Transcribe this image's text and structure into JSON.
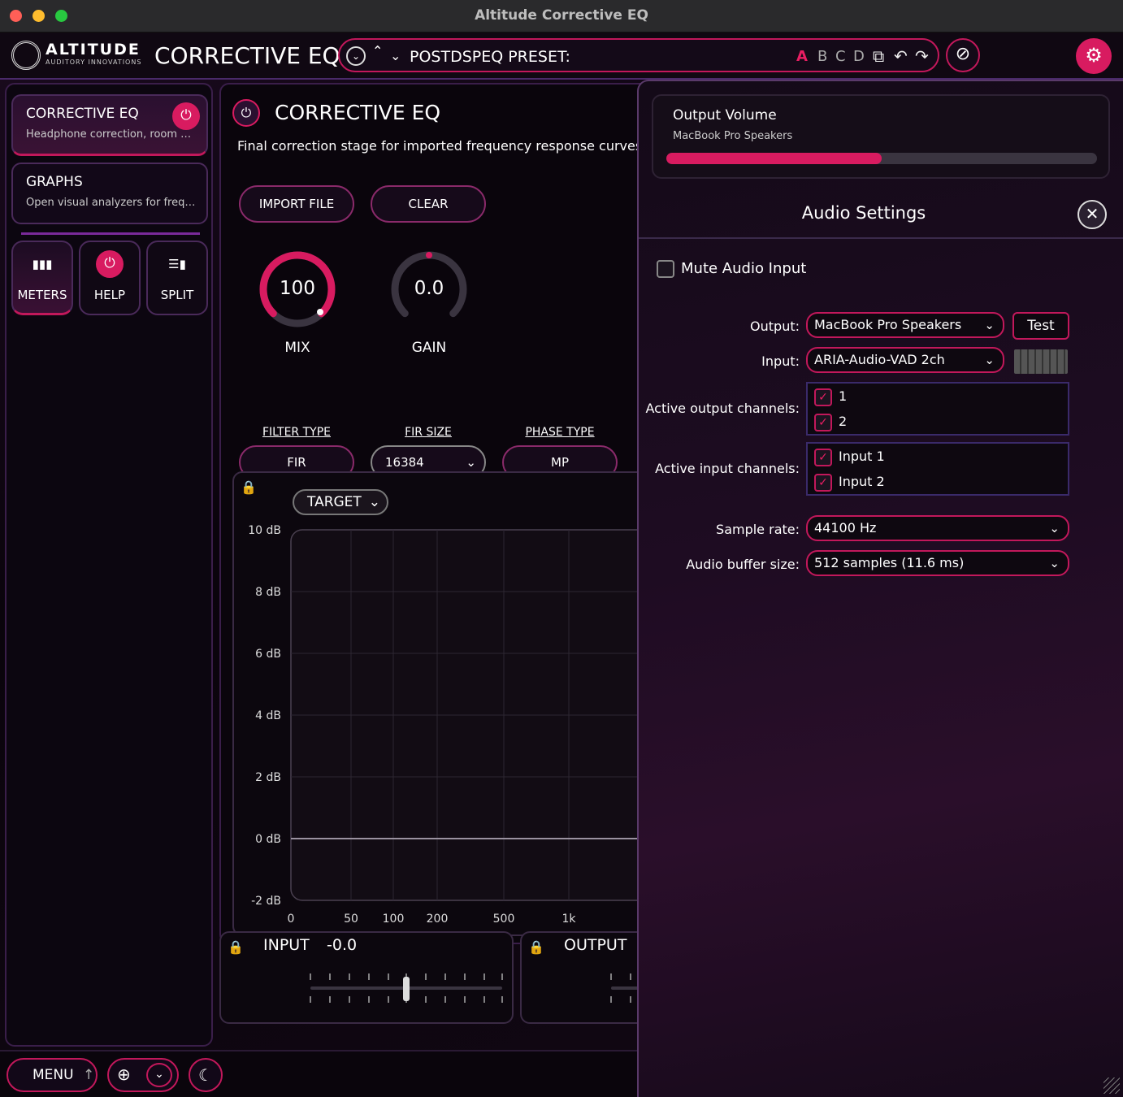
{
  "window": {
    "title": "Altitude Corrective EQ"
  },
  "topbar": {
    "brand": "ALTITUDE",
    "brand_sub": "AUDITORY INNOVATIONS",
    "app_title": "CORRECTIVE EQ",
    "preset_label": "POSTDSPEQ PRESET:",
    "slots": [
      "A",
      "B",
      "C",
      "D"
    ],
    "active_slot": "A"
  },
  "sidebar": {
    "modules": [
      {
        "title": "CORRECTIVE EQ",
        "subtitle": "Headphone correction, room cor..."
      },
      {
        "title": "GRAPHS",
        "subtitle": "Open visual analyzers for freque..."
      }
    ],
    "tools": [
      {
        "label": "METERS",
        "icon": "bar-chart-icon"
      },
      {
        "label": "HELP",
        "icon": "power-icon"
      },
      {
        "label": "SPLIT",
        "icon": "split-icon"
      }
    ]
  },
  "main": {
    "title": "CORRECTIVE EQ",
    "description": "Final correction stage for imported frequency response curves.",
    "buttons": {
      "import": "IMPORT FILE",
      "clear": "CLEAR"
    },
    "knobs": [
      {
        "label": "MIX",
        "value": "100"
      },
      {
        "label": "GAIN",
        "value": "0.0"
      }
    ],
    "params": [
      {
        "label": "FILTER TYPE",
        "value": "FIR"
      },
      {
        "label": "FIR SIZE",
        "value": "16384"
      },
      {
        "label": "PHASE TYPE",
        "value": "MP"
      }
    ],
    "graph": {
      "target_label": "TARGET",
      "y_ticks": [
        "10 dB",
        "8 dB",
        "6 dB",
        "4 dB",
        "2 dB",
        "0 dB",
        "-2 dB"
      ],
      "x_ticks": [
        "0",
        "50",
        "100",
        "200",
        "500",
        "1k"
      ]
    },
    "input": {
      "label": "INPUT",
      "value": "-0.0"
    },
    "output": {
      "label": "OUTPUT"
    }
  },
  "bottombar": {
    "menu_label": "MENU"
  },
  "audio_settings": {
    "output_volume_title": "Output Volume",
    "output_volume_device": "MacBook Pro Speakers",
    "output_volume_level": 0.5,
    "title": "Audio Settings",
    "mute_label": "Mute Audio Input",
    "output_label": "Output:",
    "output_value": "MacBook Pro Speakers",
    "test_label": "Test",
    "input_label": "Input:",
    "input_value": "ARIA-Audio-VAD 2ch",
    "active_output_label": "Active output channels:",
    "output_channels": [
      "1",
      "2"
    ],
    "active_input_label": "Active input channels:",
    "input_channels": [
      "Input 1",
      "Input 2"
    ],
    "sample_rate_label": "Sample rate:",
    "sample_rate_value": "44100 Hz",
    "buffer_label": "Audio buffer size:",
    "buffer_value": "512 samples (11.6 ms)"
  },
  "colors": {
    "accent": "#d81b60",
    "border": "#4a2a5a",
    "background": "#0a050c"
  }
}
